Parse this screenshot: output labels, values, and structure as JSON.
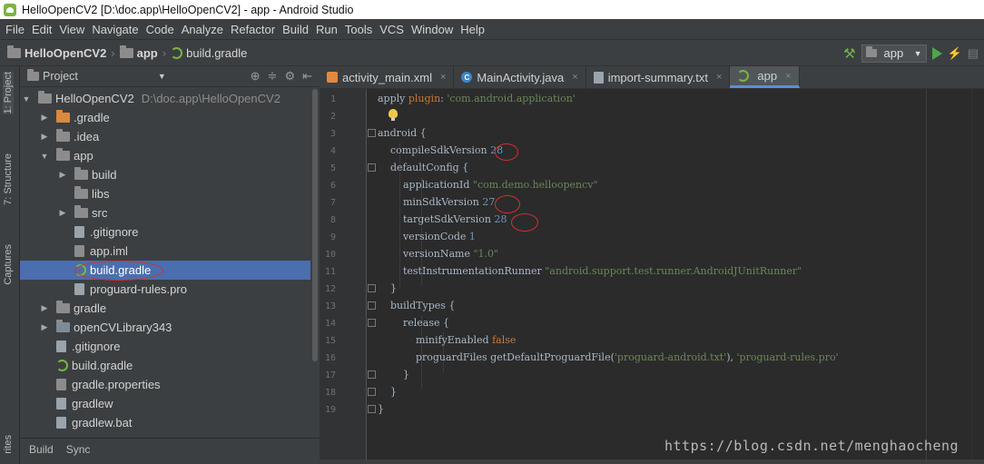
{
  "window": {
    "title": "HelloOpenCV2 [D:\\doc.app\\HelloOpenCV2] - app - Android Studio"
  },
  "menu": [
    "File",
    "Edit",
    "View",
    "Navigate",
    "Code",
    "Analyze",
    "Refactor",
    "Build",
    "Run",
    "Tools",
    "VCS",
    "Window",
    "Help"
  ],
  "breadcrumb": {
    "project": "HelloOpenCV2",
    "module": "app",
    "file": "build.gradle"
  },
  "toolbar": {
    "run_config": "app"
  },
  "side_tabs": {
    "project": "1: Project",
    "structure": "7: Structure",
    "captures": "Captures",
    "favorites": "rites"
  },
  "project_panel": {
    "title": "Project"
  },
  "tree": [
    {
      "name": "HelloOpenCV2",
      "path": "D:\\doc.app\\HelloOpenCV2",
      "toggle": "▼"
    },
    {
      "name": ".gradle",
      "toggle": "▶"
    },
    {
      "name": ".idea",
      "toggle": "▶"
    },
    {
      "name": "app",
      "toggle": "▼"
    },
    {
      "name": "build",
      "toggle": "▶"
    },
    {
      "name": "libs",
      "toggle": ""
    },
    {
      "name": "src",
      "toggle": "▶"
    },
    {
      "name": ".gitignore",
      "toggle": ""
    },
    {
      "name": "app.iml",
      "toggle": ""
    },
    {
      "name": "build.gradle",
      "toggle": ""
    },
    {
      "name": "proguard-rules.pro",
      "toggle": ""
    },
    {
      "name": "gradle",
      "toggle": "▶"
    },
    {
      "name": "openCVLibrary343",
      "toggle": "▶"
    },
    {
      "name": ".gitignore",
      "toggle": ""
    },
    {
      "name": "build.gradle",
      "toggle": ""
    },
    {
      "name": "gradle.properties",
      "toggle": ""
    },
    {
      "name": "gradlew",
      "toggle": ""
    },
    {
      "name": "gradlew.bat",
      "toggle": ""
    }
  ],
  "bottom_tabs": {
    "build": "Build",
    "sync": "Sync"
  },
  "editor_tabs": [
    {
      "label": "activity_main.xml",
      "close": "×"
    },
    {
      "label": "MainActivity.java",
      "close": "×"
    },
    {
      "label": "import-summary.txt",
      "close": "×"
    },
    {
      "label": "app",
      "close": "×"
    }
  ],
  "code_lines": [
    {
      "num": "1",
      "parts": [
        [
          "plain",
          "apply "
        ],
        [
          "kw",
          "plugin"
        ],
        [
          "plain",
          ": "
        ],
        [
          "str",
          "'com.android.application'"
        ]
      ]
    },
    {
      "num": "2",
      "parts": []
    },
    {
      "num": "3",
      "parts": [
        [
          "plain",
          "android {"
        ]
      ]
    },
    {
      "num": "4",
      "parts": [
        [
          "plain",
          "    compileSdkVersion "
        ],
        [
          "num",
          "28"
        ]
      ]
    },
    {
      "num": "5",
      "parts": [
        [
          "plain",
          "    defaultConfig {"
        ]
      ]
    },
    {
      "num": "6",
      "parts": [
        [
          "plain",
          "        applicationId "
        ],
        [
          "str",
          "\"com.demo.helloopencv\""
        ]
      ]
    },
    {
      "num": "7",
      "parts": [
        [
          "plain",
          "        minSdkVersion "
        ],
        [
          "num",
          "27"
        ]
      ]
    },
    {
      "num": "8",
      "parts": [
        [
          "plain",
          "        targetSdkVersion "
        ],
        [
          "num",
          "28"
        ]
      ]
    },
    {
      "num": "9",
      "parts": [
        [
          "plain",
          "        versionCode "
        ],
        [
          "num",
          "1"
        ]
      ]
    },
    {
      "num": "10",
      "parts": [
        [
          "plain",
          "        versionName "
        ],
        [
          "str",
          "\"1.0\""
        ]
      ]
    },
    {
      "num": "11",
      "parts": [
        [
          "plain",
          "        testInstrumentationRunner "
        ],
        [
          "str",
          "\"android.support.test.runner.AndroidJUnitRunner\""
        ]
      ]
    },
    {
      "num": "12",
      "parts": [
        [
          "plain",
          "    }"
        ]
      ]
    },
    {
      "num": "13",
      "parts": [
        [
          "plain",
          "    buildTypes {"
        ]
      ]
    },
    {
      "num": "14",
      "parts": [
        [
          "plain",
          "        release {"
        ]
      ]
    },
    {
      "num": "15",
      "parts": [
        [
          "plain",
          "            minifyEnabled "
        ],
        [
          "kw",
          "false"
        ]
      ]
    },
    {
      "num": "16",
      "parts": [
        [
          "plain",
          "            proguardFiles getDefaultProguardFile("
        ],
        [
          "str",
          "'proguard-android.txt'"
        ],
        [
          "plain",
          "), "
        ],
        [
          "str",
          "'proguard-rules.pro'"
        ]
      ]
    },
    {
      "num": "17",
      "parts": [
        [
          "plain",
          "        }"
        ]
      ]
    },
    {
      "num": "18",
      "parts": [
        [
          "plain",
          "    }"
        ]
      ]
    },
    {
      "num": "19",
      "parts": [
        [
          "plain",
          "}"
        ]
      ]
    }
  ],
  "watermark": "https://blog.csdn.net/menghaocheng",
  "colors": {
    "selection": "#4b6eaf",
    "keyword": "#cc7832",
    "string": "#6a8759",
    "number": "#6897bb",
    "annotation_circle": "#d32f2f"
  }
}
